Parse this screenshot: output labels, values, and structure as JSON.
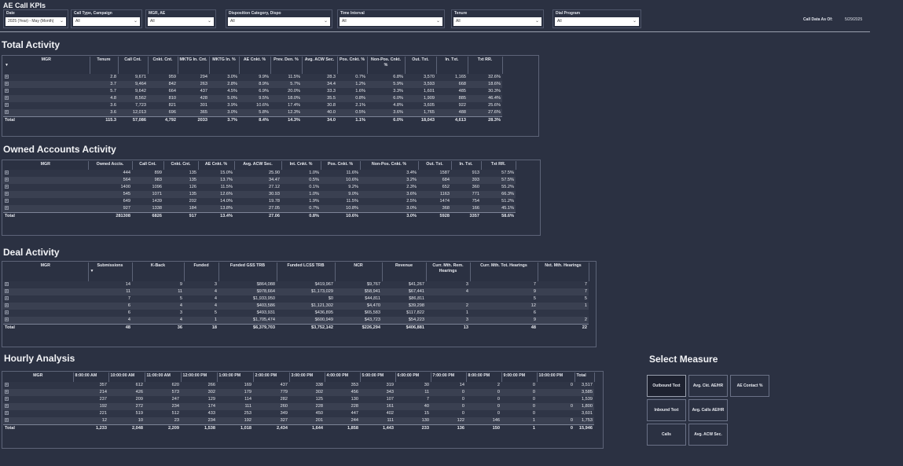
{
  "app": {
    "title": "AE Call KPIs"
  },
  "filters": [
    {
      "label": "Date",
      "value": "2025 (Year) - May (Month)"
    },
    {
      "label": "Call Type, Campaign",
      "value": "All"
    },
    {
      "label": "MGR, AE",
      "value": "All"
    },
    {
      "label": "Disposition Category, Dispo",
      "value": "All"
    },
    {
      "label": "Time Interval",
      "value": "All"
    },
    {
      "label": "Tenure",
      "value": "All"
    },
    {
      "label": "Dial Program",
      "value": "All"
    }
  ],
  "as_of": {
    "label": "Call Data As Of:",
    "value": "5/29/2025"
  },
  "total_activity": {
    "title": "Total Activity",
    "headers": [
      "MGR",
      "Tenure",
      "Call Cnt.",
      "Cnkt. Cnt.",
      "MKTG In. Cnt.",
      "MKTG In. %",
      "AE Cnkt. %",
      "Prev. Den. %",
      "Avg. ACW Sec.",
      "Pos. Cnkt. %",
      "Non-Pos. Cnkt. %",
      "Out. Txt.",
      "In. Txt.",
      "Txt RR."
    ],
    "rows": [
      [
        "",
        "2.8",
        "9,671",
        "959",
        "294",
        "3.0%",
        "9.9%",
        "11.5%",
        "28.3",
        "0.7%",
        "6.8%",
        "3,570",
        "1,165",
        "32.6%"
      ],
      [
        "",
        "3.7",
        "9,464",
        "842",
        "263",
        "2.8%",
        "8.9%",
        "5.7%",
        "34.4",
        "1.2%",
        "5.9%",
        "3,593",
        "668",
        "18.6%"
      ],
      [
        "",
        "5.7",
        "9,642",
        "664",
        "437",
        "4.5%",
        "6.9%",
        "20.0%",
        "33.3",
        "1.6%",
        "3.3%",
        "1,601",
        "485",
        "30.3%"
      ],
      [
        "",
        "4.8",
        "8,562",
        "810",
        "428",
        "5.0%",
        "9.5%",
        "18.0%",
        "35.5",
        "0.8%",
        "6.0%",
        "1,909",
        "885",
        "46.4%"
      ],
      [
        "",
        "3.6",
        "7,723",
        "821",
        "301",
        "3.9%",
        "10.6%",
        "17.4%",
        "30.8",
        "2.1%",
        "4.8%",
        "3,605",
        "922",
        "25.6%"
      ],
      [
        "",
        "3.6",
        "12,013",
        "696",
        "365",
        "3.0%",
        "5.8%",
        "12.3%",
        "40.0",
        "0.5%",
        "3.6%",
        "1,765",
        "488",
        "27.6%"
      ]
    ],
    "total": [
      "Total",
      "115.3",
      "57,086",
      "4,792",
      "2033",
      "3.7%",
      "8.4%",
      "14.3%",
      "34.0",
      "1.1%",
      "6.0%",
      "18,043",
      "4,613",
      "28.3%"
    ]
  },
  "owned_accounts": {
    "title": "Owned Accounts Activity",
    "headers": [
      "MGR",
      "Owned Accts.",
      "Call Cnt.",
      "Cnkt. Cnt.",
      "AE Cnkt. %",
      "Avg. ACW Sec.",
      "Int. Cnkt. %",
      "Pos. Cnkt. %",
      "Non-Pos. Cnkt. %",
      "Out. Txt.",
      "In. Txt.",
      "Txt RR."
    ],
    "rows": [
      [
        "",
        "444",
        "899",
        "135",
        "15.0%",
        "25.90",
        "1.0%",
        "11.6%",
        "3.4%",
        "1587",
        "913",
        "57.5%"
      ],
      [
        "",
        "564",
        "983",
        "135",
        "13.7%",
        "34.47",
        "0.5%",
        "10.6%",
        "3.2%",
        "684",
        "393",
        "57.5%"
      ],
      [
        "",
        "1400",
        "1096",
        "126",
        "11.5%",
        "27.12",
        "0.1%",
        "9.2%",
        "2.3%",
        "652",
        "360",
        "55.2%"
      ],
      [
        "",
        "545",
        "1071",
        "135",
        "12.6%",
        "30.93",
        "1.0%",
        "9.0%",
        "3.6%",
        "1163",
        "771",
        "66.3%"
      ],
      [
        "",
        "649",
        "1439",
        "202",
        "14.0%",
        "19.78",
        "1.9%",
        "11.5%",
        "2.5%",
        "1474",
        "754",
        "51.2%"
      ],
      [
        "",
        "927",
        "1338",
        "184",
        "13.8%",
        "27.05",
        "0.7%",
        "10.8%",
        "3.0%",
        "368",
        "166",
        "45.1%"
      ]
    ],
    "total": [
      "Total",
      "281308",
      "6826",
      "917",
      "13.4%",
      "27.06",
      "0.8%",
      "10.6%",
      "3.0%",
      "5928",
      "3357",
      "58.6%"
    ]
  },
  "deal_activity": {
    "title": "Deal Activity",
    "headers": [
      "MGR",
      "Submissions",
      "K-Back",
      "Funded",
      "Funded GSS TRB",
      "Funded LCSS TRB",
      "NCR",
      "Revenue",
      "Curr. Mth. Rem. Hearings",
      "Curr. Mth. Tot. Hearings",
      "Nxt. Mth. Hearings"
    ],
    "rows": [
      [
        "",
        "14",
        "9",
        "3",
        "$864,088",
        "$419,967",
        "$9,767",
        "$41,267",
        "3",
        "7",
        "7"
      ],
      [
        "",
        "11",
        "11",
        "4",
        "$978,664",
        "$1,173,029",
        "$58,941",
        "$67,441",
        "4",
        "9",
        "7"
      ],
      [
        "",
        "7",
        "5",
        "4",
        "$1,933,950",
        "$0",
        "$44,811",
        "$86,811",
        "",
        "5",
        "5"
      ],
      [
        "",
        "6",
        "4",
        "4",
        "$403,586",
        "$1,121,302",
        "$4,470",
        "$39,298",
        "2",
        "12",
        "1"
      ],
      [
        "",
        "6",
        "3",
        "5",
        "$493,931",
        "$436,895",
        "$65,583",
        "$117,822",
        "1",
        "6",
        ""
      ],
      [
        "",
        "4",
        "4",
        "1",
        "$1,705,474",
        "$600,949",
        "$43,723",
        "$54,223",
        "3",
        "9",
        "2"
      ]
    ],
    "total": [
      "Total",
      "48",
      "36",
      "18",
      "$6,379,703",
      "$3,752,142",
      "$226,294",
      "$406,881",
      "13",
      "48",
      "22"
    ]
  },
  "hourly": {
    "title": "Hourly Analysis",
    "headers": [
      "MGR",
      "8:00:00 AM",
      "10:00:00 AM",
      "11:00:00 AM",
      "12:00:00 PM",
      "1:00:00 PM",
      "2:00:00 PM",
      "3:00:00 PM",
      "4:00:00 PM",
      "5:00:00 PM",
      "6:00:00 PM",
      "7:00:00 PM",
      "8:00:00 PM",
      "9:00:00 PM",
      "10:00:00 PM",
      "Total"
    ],
    "rows": [
      [
        "",
        "357",
        "612",
        "620",
        "266",
        "169",
        "437",
        "338",
        "353",
        "319",
        "30",
        "14",
        "2",
        "0",
        "0",
        "3,517"
      ],
      [
        "",
        "214",
        "426",
        "573",
        "302",
        "179",
        "779",
        "302",
        "456",
        "343",
        "11",
        "0",
        "0",
        "0",
        "",
        "3,585"
      ],
      [
        "",
        "237",
        "209",
        "247",
        "129",
        "114",
        "282",
        "125",
        "130",
        "107",
        "7",
        "0",
        "0",
        "0",
        "",
        "1,539"
      ],
      [
        "",
        "192",
        "272",
        "234",
        "174",
        "111",
        "260",
        "228",
        "228",
        "161",
        "40",
        "0",
        "0",
        "0",
        "0",
        "1,800"
      ],
      [
        "",
        "221",
        "519",
        "512",
        "433",
        "253",
        "349",
        "450",
        "447",
        "402",
        "15",
        "0",
        "0",
        "0",
        "",
        "3,601"
      ],
      [
        "",
        "12",
        "10",
        "23",
        "234",
        "192",
        "327",
        "201",
        "244",
        "111",
        "130",
        "122",
        "146",
        "1",
        "0",
        "1,753"
      ]
    ],
    "total": [
      "Total",
      "1,233",
      "2,048",
      "2,209",
      "1,538",
      "1,018",
      "2,434",
      "1,644",
      "1,858",
      "1,443",
      "233",
      "136",
      "150",
      "1",
      "0",
      "15,946"
    ]
  },
  "measures": {
    "title": "Select Measure",
    "buttons": [
      "Outbound Text",
      "Avg. Ckt. AE/HR",
      "AE Contact %",
      "Inbound Text",
      "Avg. Calls AE/HR",
      "Calls",
      "Avg. ACW Sec."
    ],
    "selected": "Outbound Text"
  },
  "icons": {
    "expand": "plus-box-icon",
    "dropdown": "chevron-down-icon",
    "sort": "sort-down-icon"
  },
  "colors": {
    "background": "#2b3142",
    "row_alt": "#3a4051",
    "border": "#5d6478"
  }
}
